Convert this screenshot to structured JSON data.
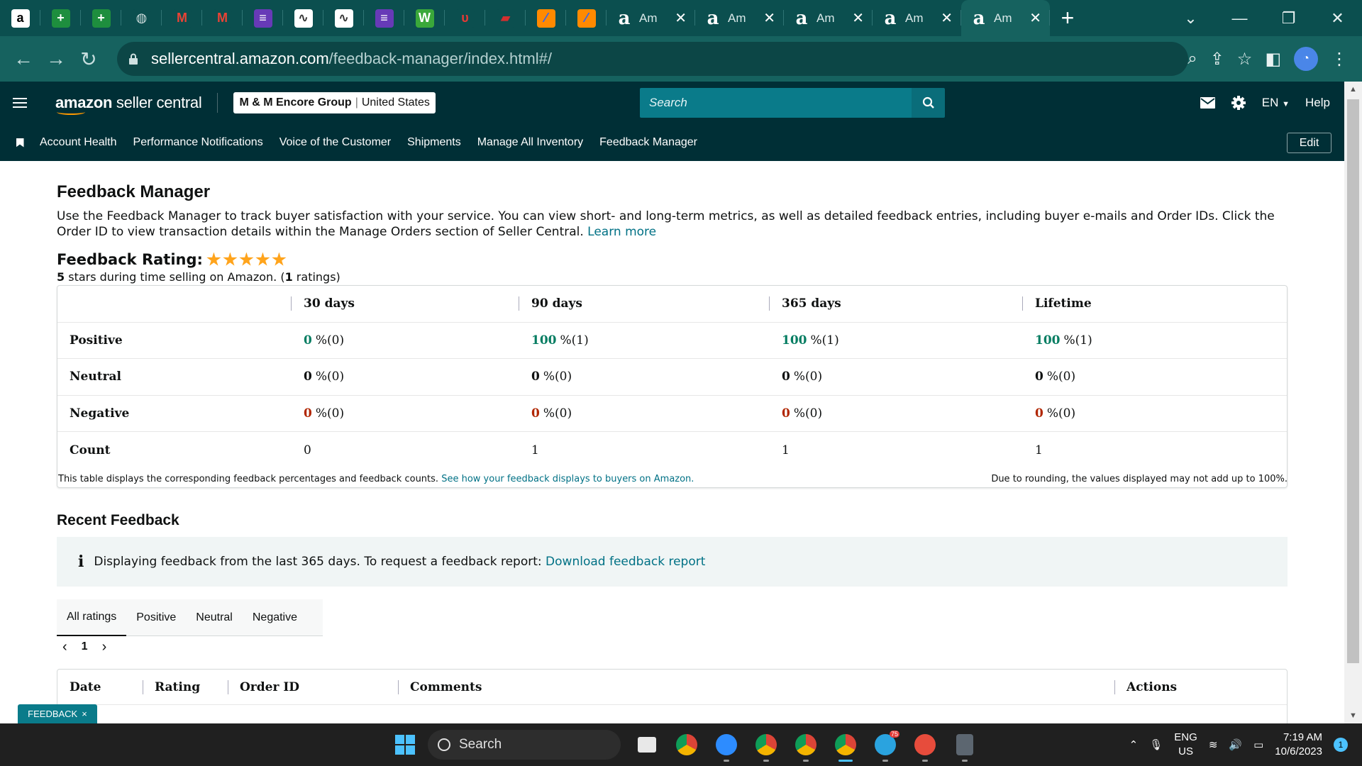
{
  "browser": {
    "pinned_tabs": [
      {
        "icon": "amazon-icon",
        "glyph": "a",
        "bg": "#ffffff",
        "fg": "#000000"
      },
      {
        "icon": "sheets-plus-icon",
        "glyph": "+",
        "bg": "#1e8e3e",
        "fg": "#ffffff"
      },
      {
        "icon": "sheets-plus-icon",
        "glyph": "+",
        "bg": "#1e8e3e",
        "fg": "#ffffff"
      },
      {
        "icon": "globe-icon",
        "glyph": "◍",
        "bg": "#0b4f4f",
        "fg": "#cfdede"
      },
      {
        "icon": "gmail-icon",
        "glyph": "M",
        "bg": "#0b4f4f",
        "fg": "#ea4335"
      },
      {
        "icon": "gmail-icon",
        "glyph": "M",
        "bg": "#0b4f4f",
        "fg": "#ea4335"
      },
      {
        "icon": "forms-list-icon",
        "glyph": "≡",
        "bg": "#673ab7",
        "fg": "#ffffff"
      },
      {
        "icon": "chart-doc-icon",
        "glyph": "∿",
        "bg": "#ffffff",
        "fg": "#333333"
      },
      {
        "icon": "chart-doc-icon",
        "glyph": "∿",
        "bg": "#ffffff",
        "fg": "#333333"
      },
      {
        "icon": "forms-list-icon",
        "glyph": "≡",
        "bg": "#673ab7",
        "fg": "#ffffff"
      },
      {
        "icon": "w-app-icon",
        "glyph": "W",
        "bg": "#3aa83a",
        "fg": "#ffffff"
      },
      {
        "icon": "u-app-icon",
        "glyph": "υ",
        "bg": "#0b4f4f",
        "fg": "#e53935"
      },
      {
        "icon": "red-app-icon",
        "glyph": "▰",
        "bg": "#0b4f4f",
        "fg": "#d32f2f"
      },
      {
        "icon": "pen-app-icon",
        "glyph": "⁄",
        "bg": "#ff8a00",
        "fg": "#2962ff"
      },
      {
        "icon": "pen-app-icon",
        "glyph": "⁄",
        "bg": "#ff8a00",
        "fg": "#2962ff"
      }
    ],
    "named_tabs": [
      {
        "title": "Am",
        "active": false
      },
      {
        "title": "Am",
        "active": false
      },
      {
        "title": "Am",
        "active": false
      },
      {
        "title": "Am",
        "active": false
      },
      {
        "title": "Am",
        "active": true
      }
    ],
    "url_host": "sellercentral.amazon.com",
    "url_path": "/feedback-manager/index.html#/"
  },
  "header": {
    "logo_a": "amazon",
    "logo_b": " seller central",
    "merchant_name": "M & M Encore Group",
    "merchant_sep": "|",
    "merchant_region": "United States",
    "search_placeholder": "Search",
    "lang": "EN",
    "help": "Help"
  },
  "nav": {
    "links": [
      "Account Health",
      "Performance Notifications",
      "Voice of the Customer",
      "Shipments",
      "Manage All Inventory",
      "Feedback Manager"
    ],
    "edit": "Edit"
  },
  "page": {
    "title": "Feedback Manager",
    "intro": "Use the Feedback Manager to track buyer satisfaction with your service. You can view short- and long-term metrics, as well as detailed feedback entries, including buyer e-mails and Order IDs. Click the Order ID to view transaction details within the Manage Orders section of Seller Central.",
    "learn_more": "Learn more",
    "rating_label": "Feedback Rating:",
    "stars": 5,
    "rating_sub_num": "5",
    "rating_sub_mid": " stars during time selling on Amazon. (",
    "rating_sub_count": "1",
    "rating_sub_end": " ratings)"
  },
  "feedback_table": {
    "columns": [
      "30 days",
      "90 days",
      "365 days",
      "Lifetime"
    ],
    "rows": [
      {
        "label": "Positive",
        "kind": "pos",
        "cells": [
          {
            "v": "0",
            "n": "%(0)"
          },
          {
            "v": "100",
            "n": "%(1)"
          },
          {
            "v": "100",
            "n": "%(1)"
          },
          {
            "v": "100",
            "n": "%(1)"
          }
        ]
      },
      {
        "label": "Neutral",
        "kind": "zer",
        "cells": [
          {
            "v": "0",
            "n": "%(0)"
          },
          {
            "v": "0",
            "n": "%(0)"
          },
          {
            "v": "0",
            "n": "%(0)"
          },
          {
            "v": "0",
            "n": "%(0)"
          }
        ]
      },
      {
        "label": "Negative",
        "kind": "neg",
        "cells": [
          {
            "v": "0",
            "n": "%(0)"
          },
          {
            "v": "0",
            "n": "%(0)"
          },
          {
            "v": "0",
            "n": "%(0)"
          },
          {
            "v": "0",
            "n": "%(0)"
          }
        ]
      },
      {
        "label": "Count",
        "kind": "count",
        "cells": [
          {
            "v": "0",
            "n": ""
          },
          {
            "v": "1",
            "n": ""
          },
          {
            "v": "1",
            "n": ""
          },
          {
            "v": "1",
            "n": ""
          }
        ]
      }
    ],
    "note_left": "This table displays the corresponding feedback percentages and feedback counts.",
    "note_link": "See how your feedback displays to buyers on Amazon.",
    "note_right": "Due to rounding, the values displayed may not add up to 100%."
  },
  "recent": {
    "title": "Recent Feedback",
    "alert_text": "Displaying feedback from the last 365 days. To request a feedback report:",
    "alert_link": "Download feedback report",
    "tabs": [
      "All ratings",
      "Positive",
      "Neutral",
      "Negative"
    ],
    "active_tab": 0,
    "page": "1",
    "columns": [
      "Date",
      "Rating",
      "Order ID",
      "Comments",
      "Actions"
    ]
  },
  "feedback_widget": {
    "label": "FEEDBACK",
    "close": "×"
  },
  "taskbar": {
    "search": "Search",
    "lang_top": "ENG",
    "lang_bottom": "US",
    "time": "7:19 AM",
    "date": "10/6/2023",
    "notifications": "1",
    "telegram_badge": "75"
  },
  "colors": {
    "brand_dark": "#002f36",
    "teal": "#0a7b8a",
    "positive": "#067d62",
    "negative": "#b12704",
    "star": "#ffa41c",
    "link": "#007185"
  }
}
